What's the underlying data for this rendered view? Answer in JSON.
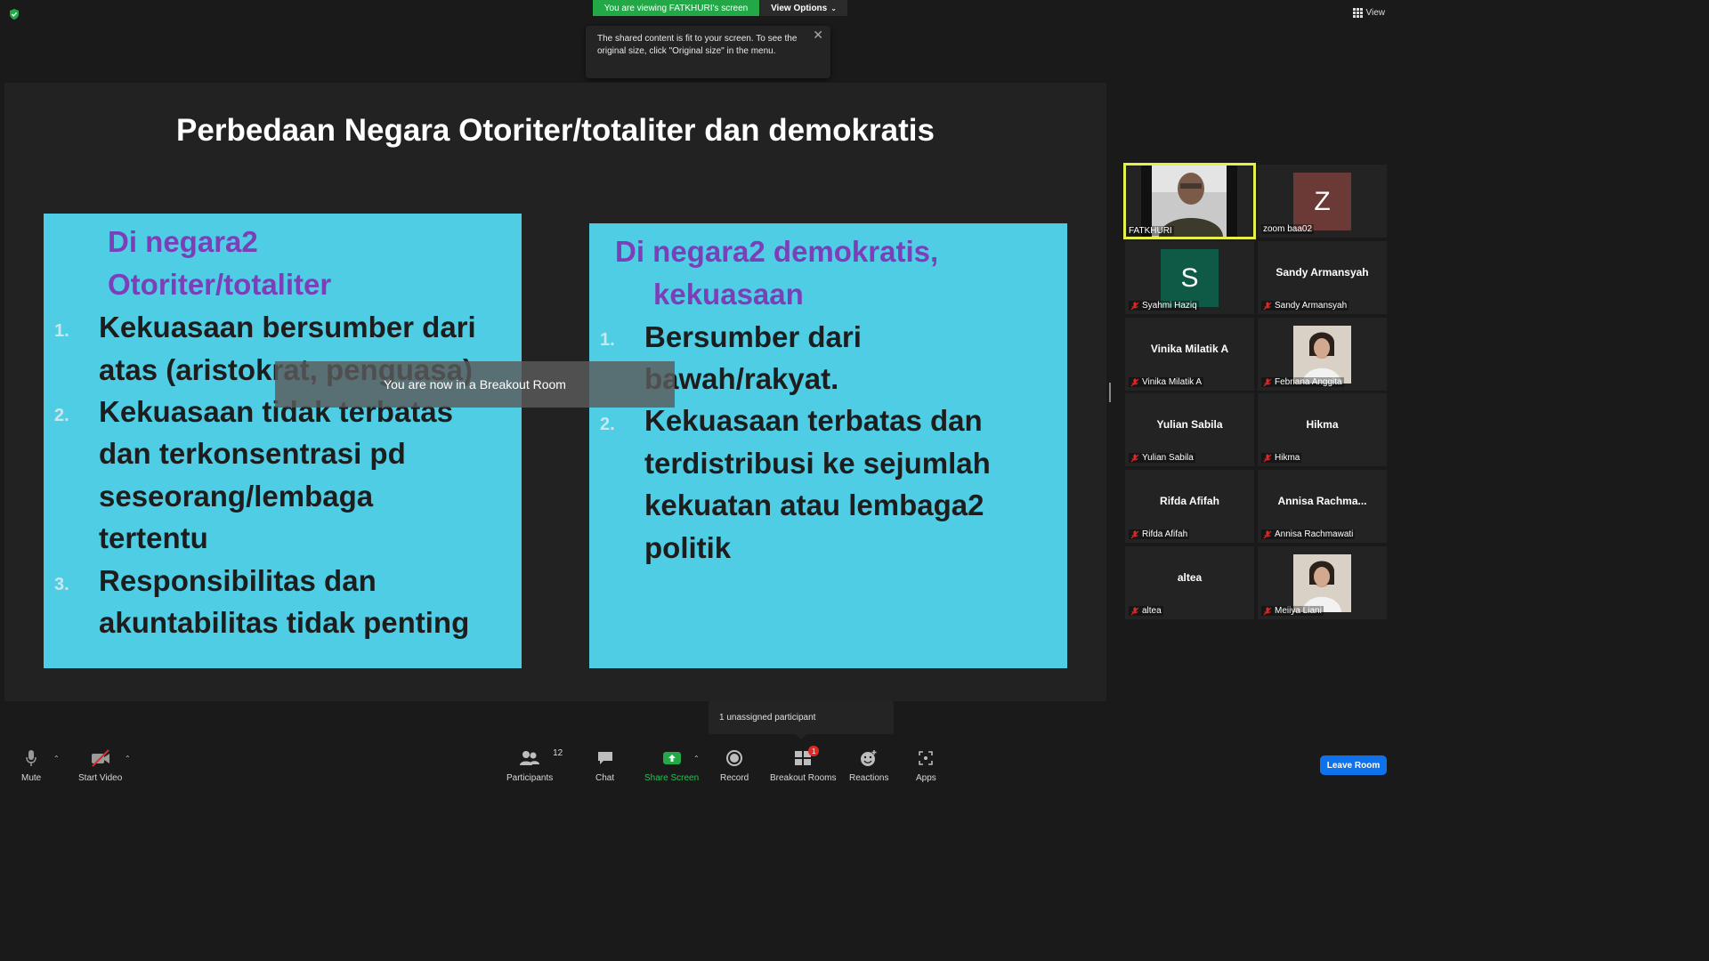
{
  "top": {
    "viewing_banner": "You are viewing FATKHURI's screen",
    "view_options": "View Options",
    "view_button": "View",
    "tooltip": "The shared content is fit to your screen. To see the original size, click \"Original size\" in the menu."
  },
  "slide": {
    "title": "Perbedaan Negara Otoriter/totaliter dan demokratis",
    "left": {
      "heading_line1": "Di negara2",
      "heading_line2": "Otoriter/totaliter",
      "items": [
        {
          "num": "1.",
          "line1": "Kekuasaan bersumber dari",
          "line2": "atas (aristokrat, penguasa)"
        },
        {
          "num": "2.",
          "line1": "Kekuasaan tidak terbatas",
          "line2": "dan terkonsentrasi pd",
          "line3": "seseorang/lembaga",
          "line4": "tertentu"
        },
        {
          "num": "3.",
          "line1": "Responsibilitas dan",
          "line2": "akuntabilitas tidak penting"
        }
      ]
    },
    "right": {
      "heading_line1": "Di negara2 demokratis,",
      "heading_line2": "kekuasaan",
      "items": [
        {
          "num": "1.",
          "line1": "Bersumber dari",
          "line2": "bawah/rakyat."
        },
        {
          "num": "2.",
          "line1": "Kekuasaan terbatas dan",
          "line2": "terdistribusi ke sejumlah",
          "line3": "kekuatan atau lembaga2",
          "line4": "politik"
        }
      ]
    }
  },
  "breakout_message": "You are now in a Breakout Room",
  "gallery": [
    {
      "label": "FATKHURI",
      "type": "video",
      "active": true,
      "muted": false
    },
    {
      "label": "zoom baa02",
      "type": "letter",
      "letter": "Z",
      "color": "#6b3a36",
      "muted": false
    },
    {
      "label": "Syahmi Haziq",
      "type": "letter",
      "letter": "S",
      "color": "#0f5a47",
      "muted": true
    },
    {
      "label": "Sandy Armansyah",
      "type": "name",
      "display": "Sandy Armansyah",
      "muted": true
    },
    {
      "label": "Vinika Milatik A",
      "type": "name",
      "display": "Vinika Milatik A",
      "muted": true
    },
    {
      "label": "Febriana Anggita",
      "type": "photo",
      "muted": true
    },
    {
      "label": "Yulian Sabila",
      "type": "name",
      "display": "Yulian Sabila",
      "muted": true
    },
    {
      "label": "Hikma",
      "type": "name",
      "display": "Hikma",
      "muted": true
    },
    {
      "label": "Rifda Afifah",
      "type": "name",
      "display": "Rifda Afifah",
      "muted": true
    },
    {
      "label": "Annisa Rachmawati",
      "type": "name",
      "display": "Annisa  Rachma...",
      "muted": true
    },
    {
      "label": "altea",
      "type": "name",
      "display": "altea",
      "muted": true
    },
    {
      "label": "Meiiya Liani",
      "type": "photo",
      "muted": true
    }
  ],
  "toolbar": {
    "mute": "Mute",
    "start_video": "Start Video",
    "participants": "Participants",
    "participants_count": "12",
    "chat": "Chat",
    "share_screen": "Share Screen",
    "record": "Record",
    "breakout_rooms": "Breakout Rooms",
    "breakout_badge": "1",
    "reactions": "Reactions",
    "apps": "Apps",
    "leave_room": "Leave Room"
  },
  "unassigned_popup": "1 unassigned participant",
  "colors": {
    "share_green": "#23a847",
    "slide_box": "#4ecde4",
    "heading_purple": "#7b3fb8",
    "leave_blue": "#0e72ed",
    "active_speaker": "#e6f04a"
  }
}
